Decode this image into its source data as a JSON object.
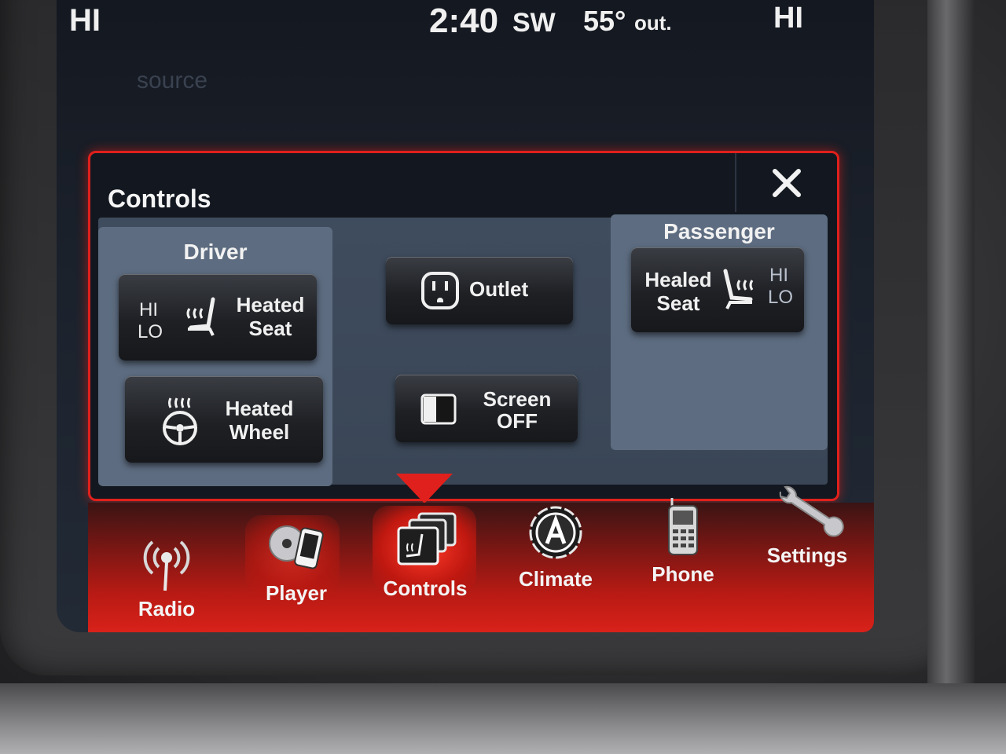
{
  "status_bar": {
    "left_temp": "HI",
    "time": "2:40",
    "heading": "SW",
    "outside_temp": "55°",
    "outside_label": "out.",
    "right_temp": "HI"
  },
  "background_ghost": {
    "source_label": "source"
  },
  "controls_popup": {
    "title": "Controls",
    "driver": {
      "title": "Driver",
      "heated_seat": {
        "hi": "HI",
        "lo": "LO",
        "line1": "Heated",
        "line2": "Seat"
      },
      "heated_wheel": {
        "line1": "Heated",
        "line2": "Wheel"
      }
    },
    "center": {
      "outlet": {
        "label": "Outlet"
      },
      "screen_off": {
        "line1": "Screen",
        "line2": "OFF"
      }
    },
    "passenger": {
      "title": "Passenger",
      "heated_seat": {
        "hi": "HI",
        "lo": "LO",
        "line1": "Healed",
        "line2": "Seat"
      }
    }
  },
  "nav": {
    "active": "Controls",
    "items": [
      {
        "label": "Radio",
        "icon": "radio-icon"
      },
      {
        "label": "Player",
        "icon": "player-icon"
      },
      {
        "label": "Controls",
        "icon": "controls-icon"
      },
      {
        "label": "Climate",
        "icon": "climate-icon"
      },
      {
        "label": "Phone",
        "icon": "phone-icon"
      },
      {
        "label": "Settings",
        "icon": "settings-icon"
      }
    ]
  },
  "colors": {
    "accent_red": "#e0201c",
    "button_dark": "#1e2024",
    "zone_blue": "#5d6c80",
    "panel_blue": "#3f4c5e"
  }
}
